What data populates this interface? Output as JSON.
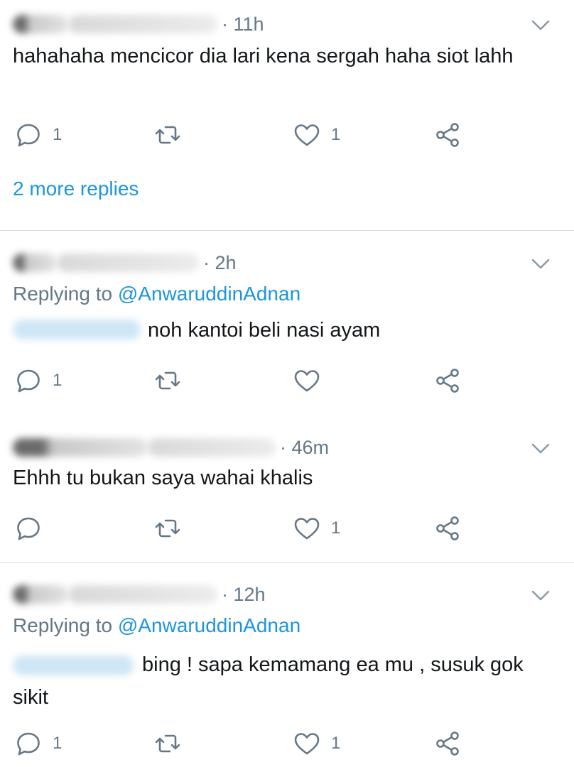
{
  "tweets": [
    {
      "time": "· 11h",
      "replying_prefix": "",
      "replying_handle": "",
      "text": "hahahaha mencicor dia lari kena sergah haha siot lahh",
      "reply_count": "1",
      "like_count": "1",
      "more_replies": "2 more replies"
    },
    {
      "time": "· 2h",
      "replying_prefix": "Replying to ",
      "replying_handle": "@AnwaruddinAdnan",
      "text": "noh kantoi beli nasi ayam",
      "reply_count": "1",
      "like_count": ""
    },
    {
      "time": "· 46m",
      "text": "Ehhh tu bukan saya wahai khalis",
      "reply_count": "",
      "like_count": "1"
    },
    {
      "time": "· 12h",
      "replying_prefix": "Replying to ",
      "replying_handle": "@AnwaruddinAdnan",
      "text": "bing ! sapa kemamang ea mu , susuk gok sikit",
      "reply_count": "1",
      "like_count": "1"
    }
  ],
  "colors": {
    "text": "#14171a",
    "secondary": "#657786",
    "link": "#1b95e0",
    "divider": "#d6d9dc"
  },
  "icons": [
    "reply-icon",
    "retweet-icon",
    "like-icon",
    "share-icon",
    "chevron-down-icon"
  ]
}
